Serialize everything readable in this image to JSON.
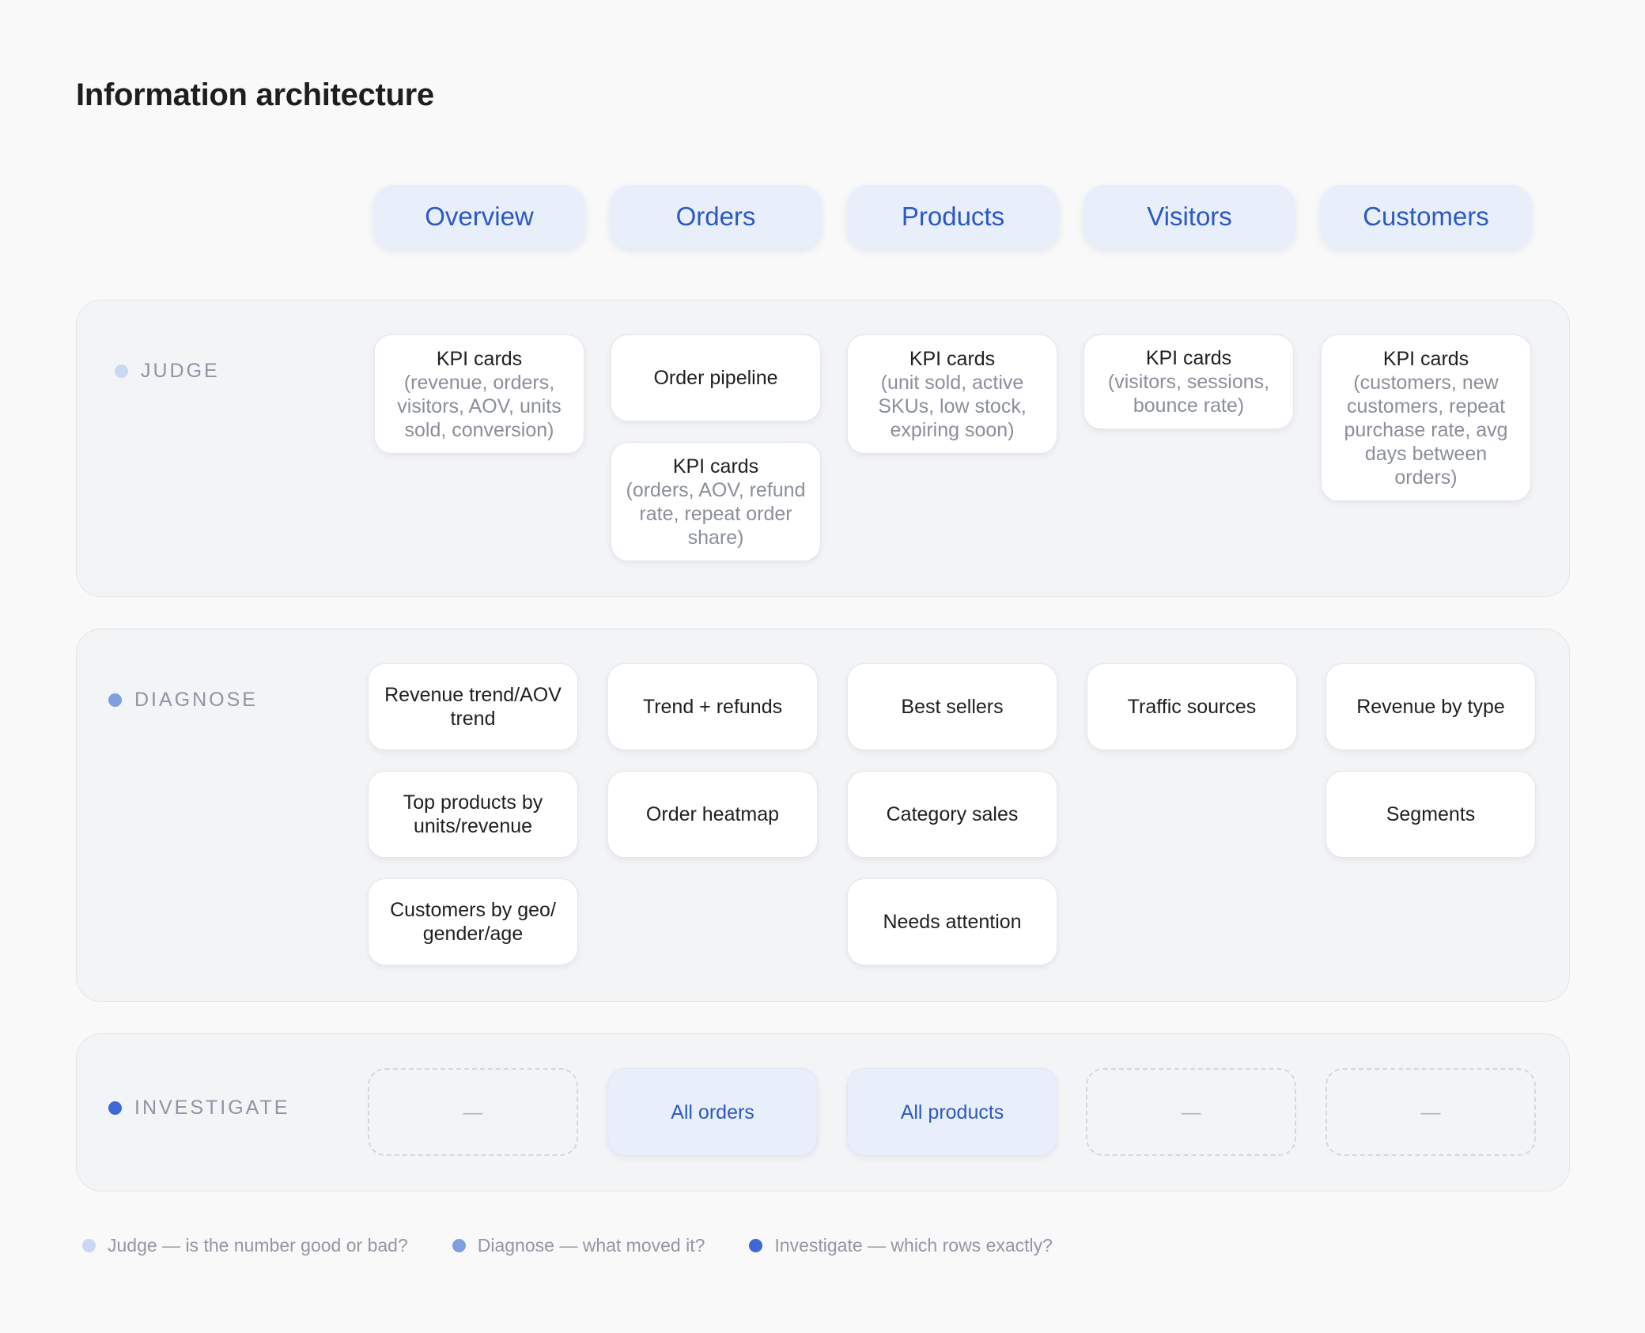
{
  "page": {
    "title": "Information architecture"
  },
  "columns": [
    "Overview",
    "Orders",
    "Products",
    "Visitors",
    "Customers"
  ],
  "colors": {
    "judge_dot": "#c9d7f3",
    "diagnose_dot": "#7f9fe0",
    "investigate_dot": "#3d68d8",
    "tab_bg": "#e8effb",
    "tab_text": "#2b59c3"
  },
  "sections": {
    "judge": {
      "label": "JUDGE",
      "cards": {
        "overview_kpi": {
          "title": "KPI cards",
          "detail": "(revenue, orders, visitors, AOV, units sold, conversion)"
        },
        "orders_pipeline": {
          "title": "Order pipeline"
        },
        "orders_kpi": {
          "title": "KPI cards",
          "detail": "(orders, AOV, refund rate, repeat order share)"
        },
        "products_kpi": {
          "title": "KPI cards",
          "detail": "(unit sold, active SKUs, low stock, expiring soon)"
        },
        "visitors_kpi": {
          "title": "KPI cards",
          "detail": "(visitors, sessions, bounce rate)"
        },
        "customers_kpi": {
          "title": "KPI cards",
          "detail": "(customers, new customers, repeat purchase rate, avg days between orders)"
        }
      }
    },
    "diagnose": {
      "label": "DIAGNOSE",
      "cards": {
        "overview_revenue_trend": {
          "title": "Revenue trend/AOV trend"
        },
        "overview_top_products": {
          "title": "Top products by units/revenue"
        },
        "overview_customers_geo": {
          "title": "Customers by geo/ gender/age"
        },
        "orders_trend_refunds": {
          "title": "Trend + refunds"
        },
        "orders_heatmap": {
          "title": "Order heatmap"
        },
        "products_best_sellers": {
          "title": "Best sellers"
        },
        "products_category_sales": {
          "title": "Category sales"
        },
        "products_needs_attention": {
          "title": "Needs attention"
        },
        "visitors_traffic_sources": {
          "title": "Traffic sources"
        },
        "customers_revenue_by_type": {
          "title": "Revenue by type"
        },
        "customers_segments": {
          "title": "Segments"
        }
      }
    },
    "investigate": {
      "label": "INVESTIGATE",
      "cards": {
        "overview": {
          "title": "—"
        },
        "orders": {
          "title": "All orders"
        },
        "products": {
          "title": "All products"
        },
        "visitors": {
          "title": "—"
        },
        "customers": {
          "title": "—"
        }
      }
    }
  },
  "legend": [
    {
      "text": "Judge — is the number good or bad?"
    },
    {
      "text": "Diagnose — what moved it?"
    },
    {
      "text": "Investigate — which rows exactly?"
    }
  ]
}
